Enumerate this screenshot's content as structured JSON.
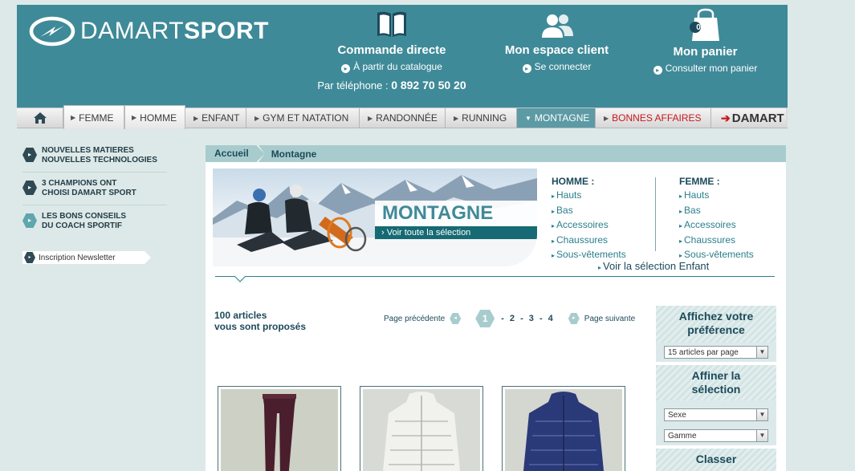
{
  "header": {
    "brand_light": "DAMART",
    "brand_bold": "SPORT",
    "order": {
      "title": "Commande directe",
      "sub": "À partir du catalogue",
      "phone_label": "Par téléphone :",
      "phone": "0 892 70 50 20"
    },
    "account": {
      "title": "Mon espace client",
      "sub": "Se connecter"
    },
    "cart": {
      "title": "Mon panier",
      "sub": "Consulter mon panier",
      "count": "0"
    }
  },
  "nav": {
    "items": [
      "FEMME",
      "HOMME",
      "ENFANT",
      "GYM ET NATATION",
      "RANDONNÉE",
      "RUNNING",
      "MONTAGNE",
      "BONNES AFFAIRES"
    ],
    "brand": "DAMART"
  },
  "sidebar": {
    "items": [
      {
        "label": "NOUVELLES MATIERES\nNOUVELLES TECHNOLOGIES"
      },
      {
        "label": "3 CHAMPIONS ONT\nCHOISI DAMART SPORT"
      },
      {
        "label": "LES BONS CONSEILS\nDU COACH SPORTIF"
      }
    ],
    "newsletter": "Inscription Newsletter"
  },
  "breadcrumb": [
    "Accueil",
    "Montagne"
  ],
  "banner": {
    "title": "MONTAGNE",
    "cta": "Voir toute la sélection"
  },
  "categories": {
    "homme": {
      "title": "HOMME :",
      "links": [
        "Hauts",
        "Bas",
        "Accessoires",
        "Chaussures",
        "Sous-vêtements"
      ]
    },
    "femme": {
      "title": "FEMME :",
      "links": [
        "Hauts",
        "Bas",
        "Accessoires",
        "Chaussures",
        "Sous-vêtements"
      ]
    },
    "enfant": "Voir la sélection Enfant"
  },
  "listing": {
    "count_line1": "100 articles",
    "count_line2": "vous sont proposés",
    "prev": "Page précédente",
    "current": "1",
    "pages": "- 2 - 3 - 4",
    "next": "Page suivante"
  },
  "filters": {
    "pref_title": "Affichez votre préférence",
    "per_page": "15 articles par page",
    "refine_title": "Affiner la sélection",
    "sexe": "Sexe",
    "gamme": "Gamme",
    "sort_title": "Classer"
  },
  "colors": {
    "header": "#3f8a98",
    "accent": "#2a7f8c",
    "deal": "#c8181d"
  }
}
